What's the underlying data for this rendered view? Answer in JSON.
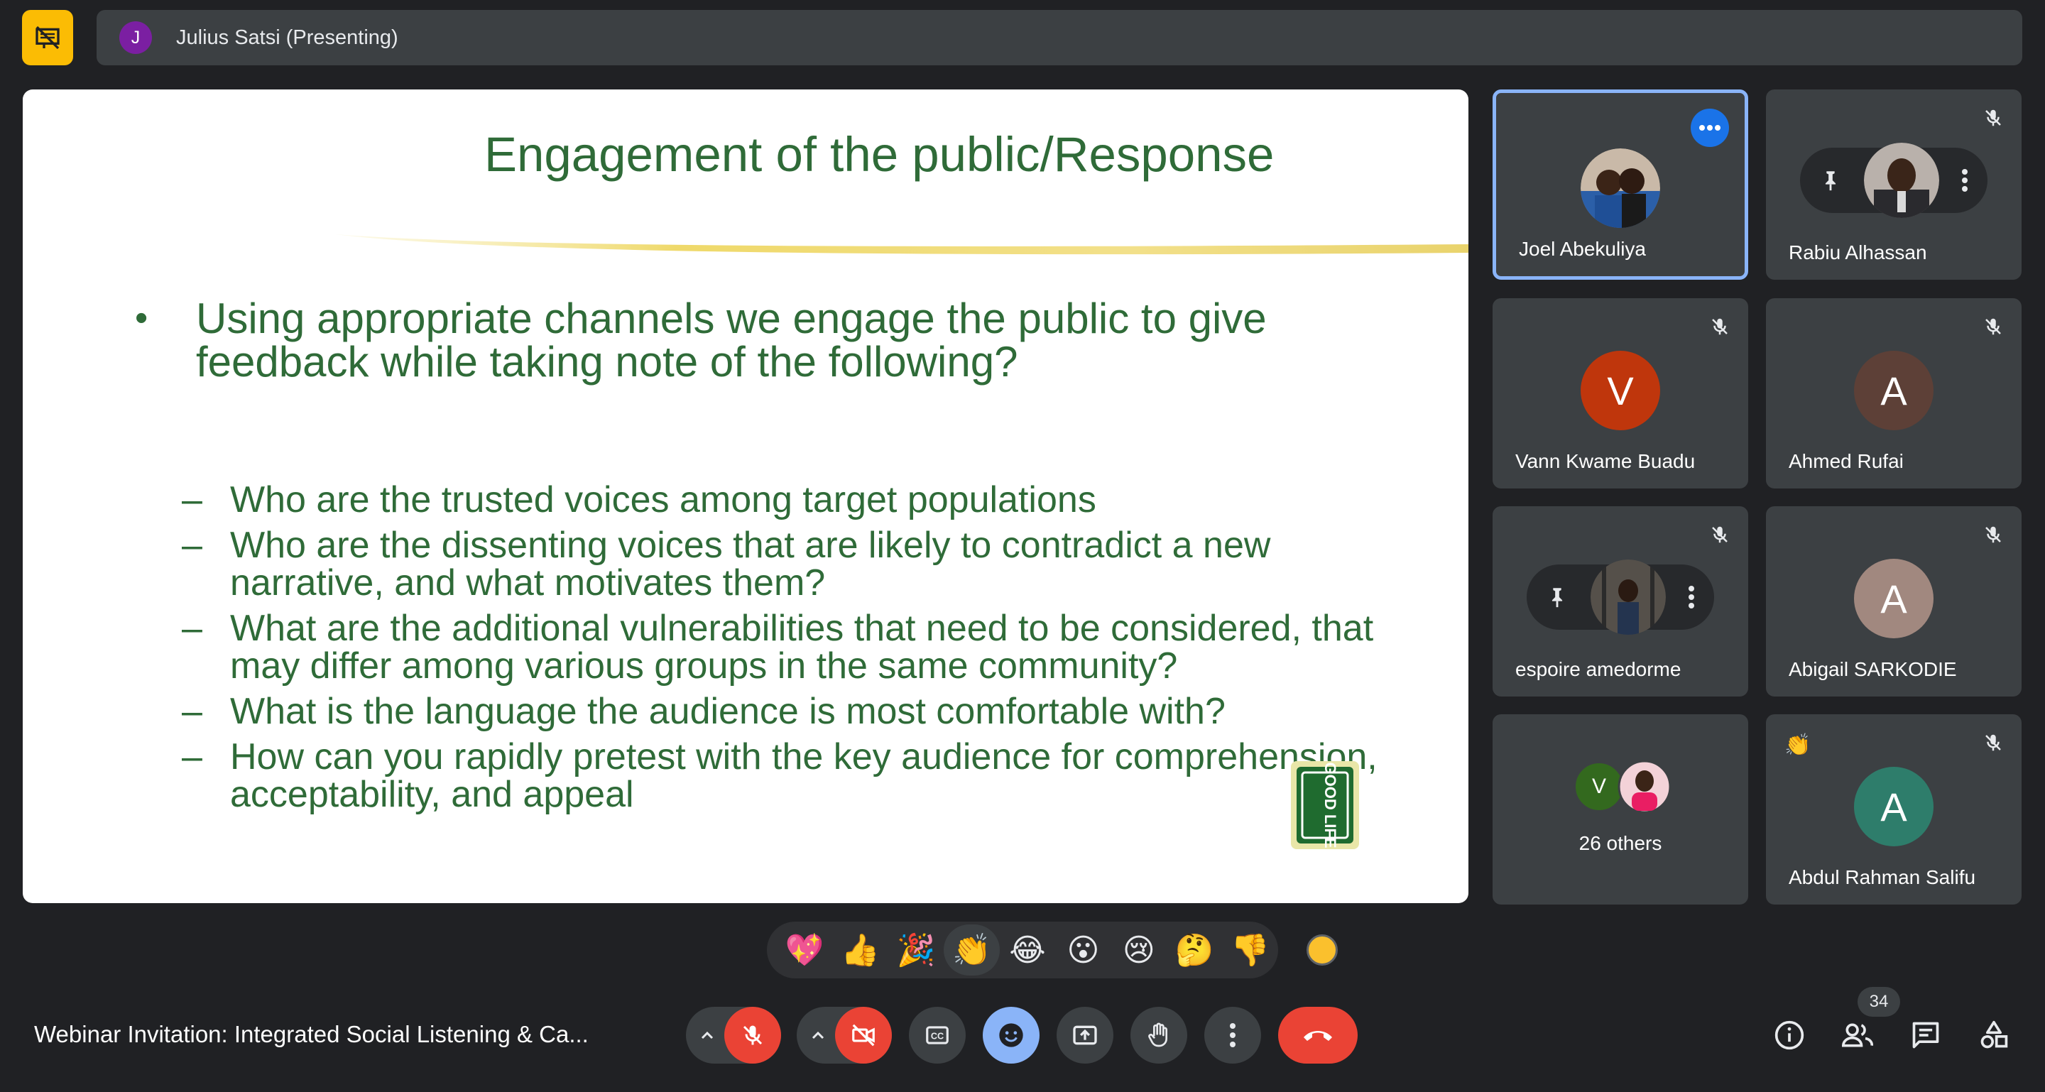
{
  "header": {
    "presenter_initial": "J",
    "presenter_label": "Julius Satsi (Presenting)"
  },
  "slide": {
    "title": "Engagement of the public/Response",
    "bullet": "Using appropriate channels we engage the public to give feedback while taking note of the following?",
    "bullet_symbol": "•",
    "dash_symbol": "–",
    "subpoints": [
      "Who are the trusted voices among target populations",
      "Who are the dissenting voices that are likely to contradict a new narrative, and what motivates them?",
      "What are the additional vulnerabilities that need to be considered, that may differ among various groups in the same community?",
      "What is the language the audience is most comfortable with?",
      "How can you rapidly pretest with the key audience for comprehension, acceptability, and appeal"
    ],
    "logo_text": "GOOD LIFE"
  },
  "participants": [
    {
      "name": "Joel Abekuliya"
    },
    {
      "name": "Rabiu Alhassan"
    },
    {
      "name": "Vann Kwame Buadu",
      "initial": "V"
    },
    {
      "name": "Ahmed Rufai",
      "initial": "A"
    },
    {
      "name": "espoire amedorme"
    },
    {
      "name": "Abigail SARKODIE",
      "initial": "A"
    },
    {
      "name": "26 others",
      "initial": "V"
    },
    {
      "name": "Abdul Rahman Salifu",
      "initial": "A"
    }
  ],
  "reactions": [
    "💖",
    "👍",
    "🎉",
    "👏",
    "😂",
    "😮",
    "😢",
    "🤔",
    "👎"
  ],
  "clap_emoji": "👏",
  "footer": {
    "meeting_title": "Webinar Invitation: Integrated Social Listening & Ca...",
    "participant_count": "34"
  },
  "colors": {
    "accent_blue": "#8ab4f8",
    "hangup_red": "#ea4335",
    "slide_green": "#2f6b38",
    "pin_yellow": "#fbbc04"
  }
}
